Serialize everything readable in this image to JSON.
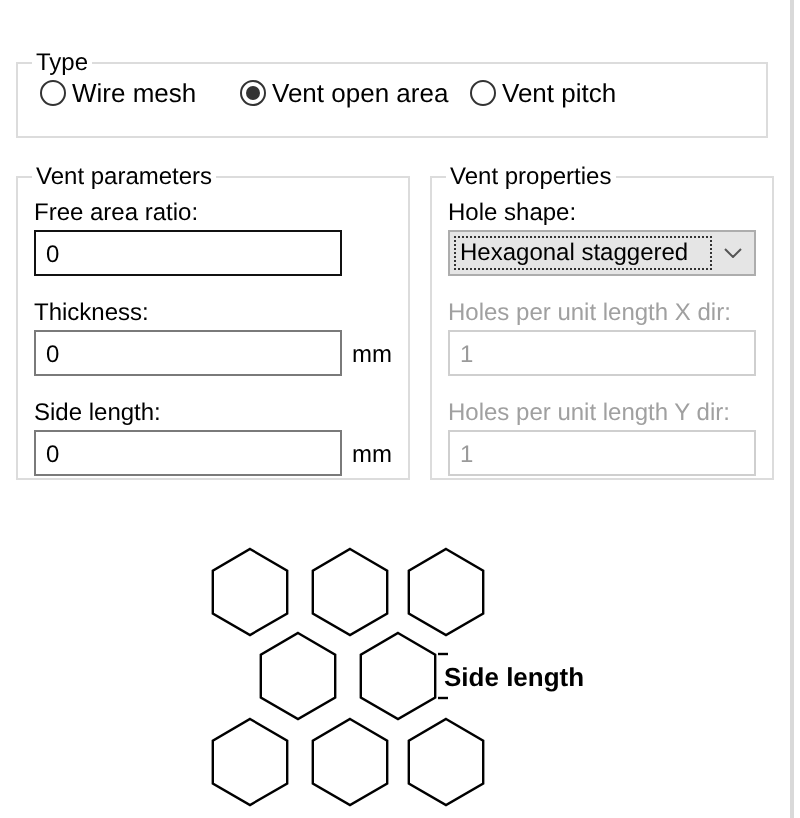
{
  "type_group": {
    "title": "Type",
    "options": [
      {
        "label": "Wire mesh",
        "selected": false
      },
      {
        "label": "Vent open area",
        "selected": true
      },
      {
        "label": "Vent pitch",
        "selected": false
      }
    ]
  },
  "vent_parameters": {
    "title": "Vent parameters",
    "fields": [
      {
        "label": "Free area ratio:",
        "value": "0",
        "focused": true
      },
      {
        "label": "Thickness:",
        "value": "0",
        "unit": "mm",
        "focused": false
      },
      {
        "label": "Side length:",
        "value": "0",
        "unit": "mm",
        "focused": false
      }
    ]
  },
  "vent_properties": {
    "title": "Vent properties",
    "hole_shape": {
      "label": "Hole shape:",
      "value": "Hexagonal staggered"
    },
    "fields": [
      {
        "label": "Holes per unit length X dir:",
        "value": "1",
        "disabled": true
      },
      {
        "label": "Holes per unit length Y dir:",
        "value": "1",
        "disabled": true
      }
    ]
  },
  "diagram": {
    "label": "Side length"
  }
}
